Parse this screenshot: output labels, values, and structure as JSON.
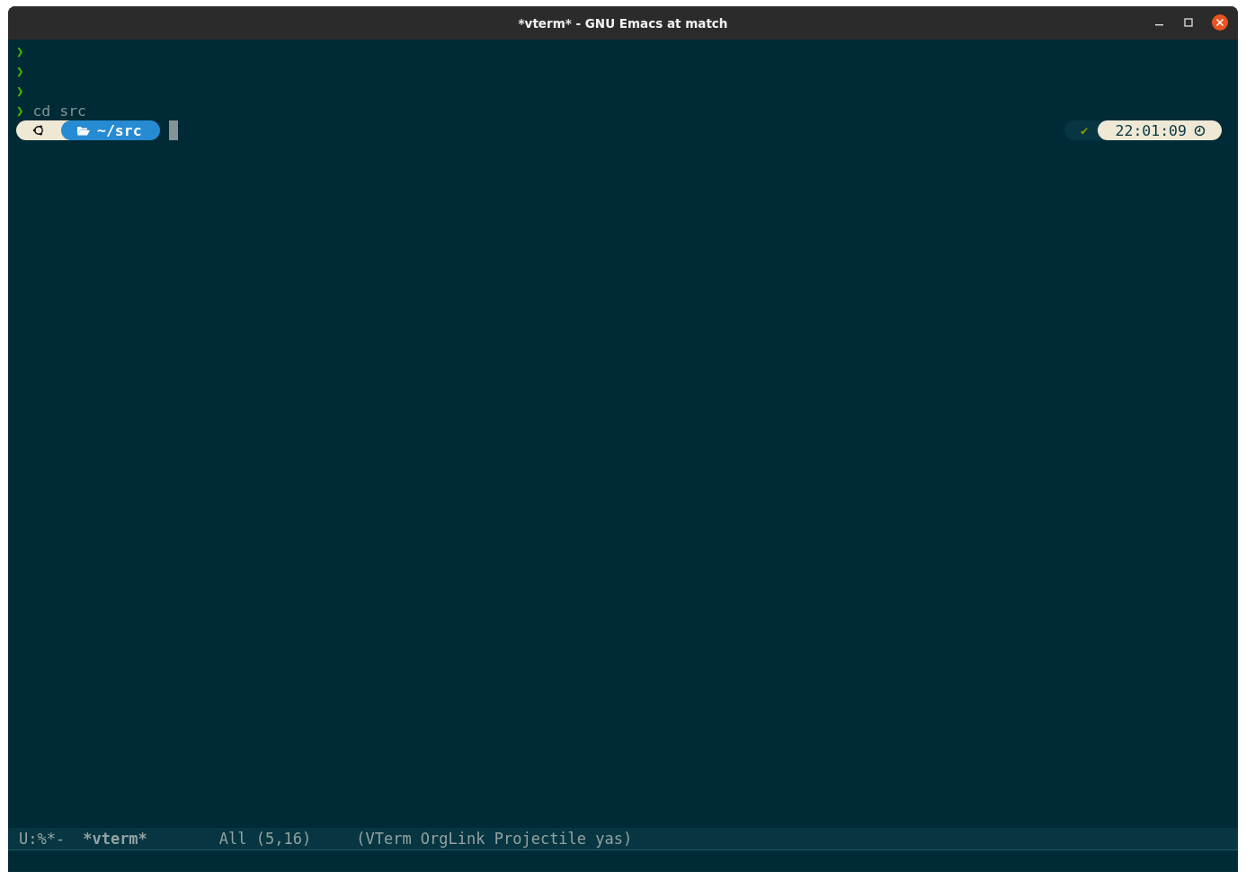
{
  "window": {
    "title": "*vterm* - GNU Emacs at match"
  },
  "terminal": {
    "lines": [
      {
        "prompt": "❯"
      },
      {
        "prompt": "❯"
      },
      {
        "prompt": "❯"
      },
      {
        "prompt": "❯",
        "command": "cd src"
      }
    ],
    "prompt_bar": {
      "directory": "~/src",
      "status_symbol": "✔",
      "time": "22:01:09"
    }
  },
  "mode_line": {
    "state": "U:%*-",
    "buffer": "*vterm*",
    "position": "All (5,16)",
    "modes": "(VTerm OrgLink Projectile yas)"
  }
}
